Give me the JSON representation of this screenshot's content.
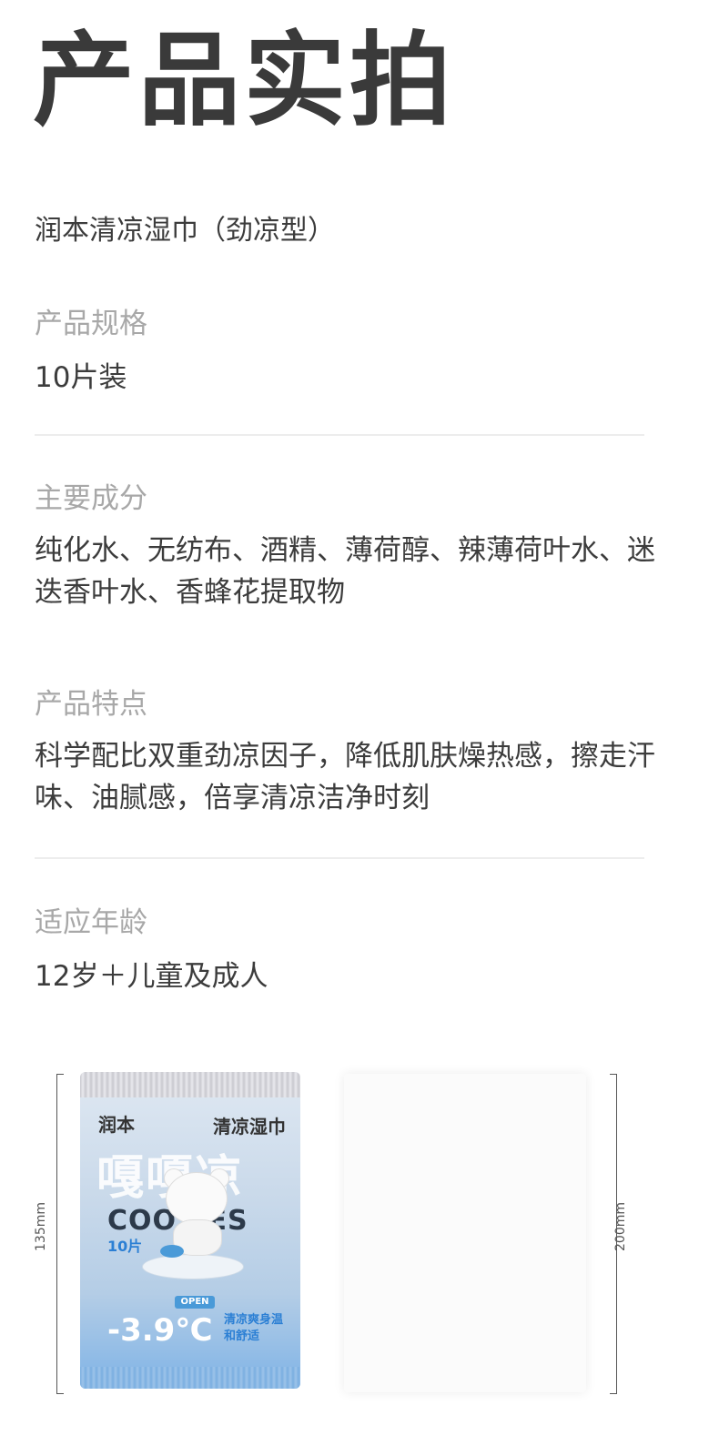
{
  "header": {
    "title": "产品实拍"
  },
  "product": {
    "name": "润本清凉湿巾（劲凉型）"
  },
  "sections": [
    {
      "label": "产品规格",
      "value": "10片装"
    },
    {
      "label": "主要成分",
      "value": "纯化水、无纺布、酒精、薄荷醇、辣薄荷叶水、迷迭香叶水、香蜂花提取物"
    },
    {
      "label": "产品特点",
      "value": "科学配比双重劲凉因子，降低肌肤燥热感，擦走汗味、油腻感，倍享清凉洁净时刻"
    },
    {
      "label": "适应年龄",
      "value": "12岁＋儿童及成人"
    }
  ],
  "dimensions": {
    "left": "135mm",
    "right": "200mm"
  },
  "package": {
    "brand": "润本",
    "type": "清凉湿巾",
    "big_text": "嘎嘎凉",
    "cool_text": "COO PES",
    "count": "10片",
    "open": "OPEN",
    "temp": "-3.9℃",
    "note": "清凉爽身温和舒适"
  }
}
